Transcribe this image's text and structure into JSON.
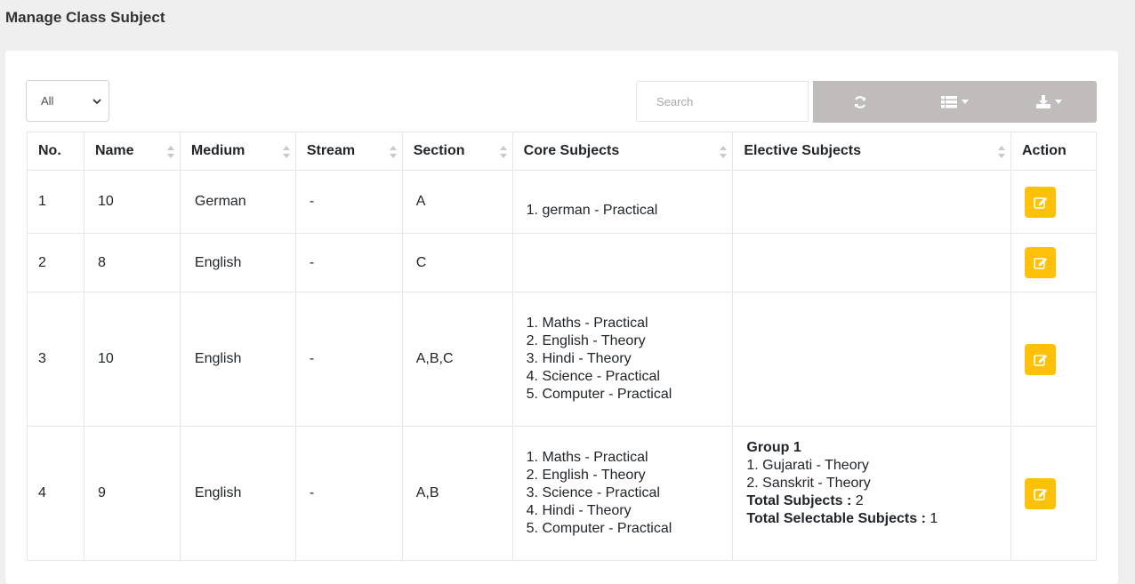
{
  "page": {
    "title": "Manage Class Subject"
  },
  "filter": {
    "selected": "All"
  },
  "search": {
    "placeholder": "Search"
  },
  "toolbar": {
    "buttons": [
      {
        "icon": "refresh-icon"
      },
      {
        "icon": "columns-icon"
      },
      {
        "icon": "export-icon"
      }
    ],
    "color": "#c1bcbc"
  },
  "table": {
    "headers": [
      "No.",
      "Name",
      "Medium",
      "Stream",
      "Section",
      "Core Subjects",
      "Elective Subjects",
      "Action"
    ],
    "rows": [
      {
        "no": "1",
        "name": "10",
        "medium": "German",
        "stream": "-",
        "section": "A",
        "core": [
          "1. german - Practical"
        ],
        "elective": null
      },
      {
        "no": "2",
        "name": "8",
        "medium": "English",
        "stream": "-",
        "section": "C",
        "core": [],
        "elective": null
      },
      {
        "no": "3",
        "name": "10",
        "medium": "English",
        "stream": "-",
        "section": "A,B,C",
        "core": [
          "1. Maths - Practical",
          "2. English - Theory",
          "3. Hindi - Theory",
          "4. Science - Practical",
          "5. Computer - Practical"
        ],
        "elective": null
      },
      {
        "no": "4",
        "name": "9",
        "medium": "English",
        "stream": "-",
        "section": "A,B",
        "core": [
          "1. Maths - Practical",
          "2. English - Theory",
          "3. Science - Practical",
          "4. Hindi - Theory",
          "5. Computer - Practical"
        ],
        "elective": {
          "group": "Group 1",
          "subjects": [
            "1. Gujarati - Theory",
            "2. Sanskrit - Theory"
          ],
          "total_label": "Total Subjects :",
          "total_value": "2",
          "selectable_label": "Total Selectable Subjects :",
          "selectable_value": "1"
        }
      }
    ]
  },
  "colors": {
    "action_button": "#ffc107"
  }
}
